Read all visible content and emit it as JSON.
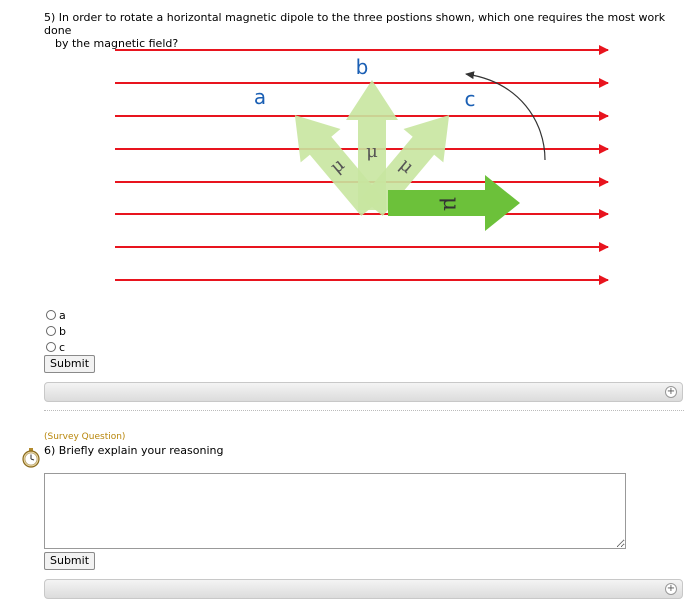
{
  "question5": {
    "line1": "5) In order to rotate a horizontal magnetic dipole to the three postions shown, which one requires the most work done",
    "line2": "by the magnetic field?",
    "figure": {
      "label_a": "a",
      "label_b": "b",
      "label_c": "c",
      "mu": "μ",
      "field_color": "#e8141e",
      "arrow_light_color": "#c8e6a0",
      "arrow_dark_color": "#6cc13a"
    },
    "options": [
      "a",
      "b",
      "c"
    ],
    "submit_label": "Submit"
  },
  "question6": {
    "survey_tag": "(Survey Question)",
    "text": "6) Briefly explain your reasoning",
    "submit_label": "Submit"
  }
}
